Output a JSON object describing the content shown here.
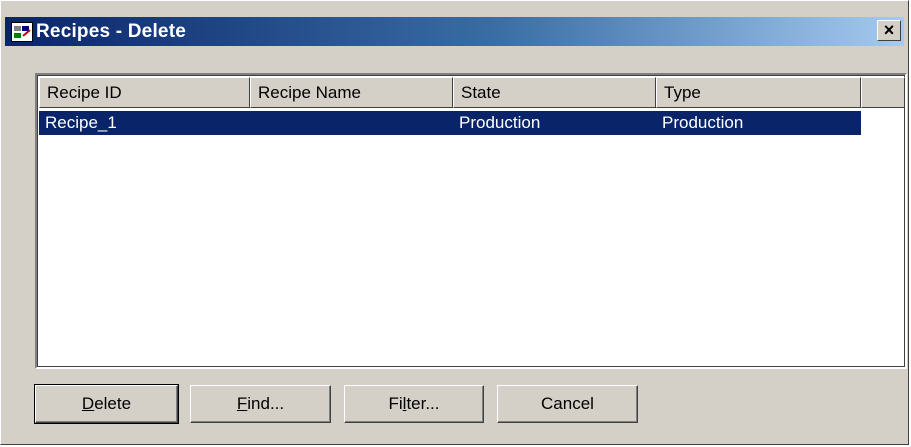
{
  "window": {
    "title": "Recipes - Delete",
    "close_label": "×"
  },
  "list": {
    "columns": [
      "Recipe ID",
      "Recipe Name",
      "State",
      "Type"
    ],
    "rows": [
      {
        "recipe_id": "Recipe_1",
        "recipe_name": "",
        "state": "Production",
        "type": "Production",
        "selected": true
      }
    ]
  },
  "buttons": {
    "delete": {
      "mnemonic": "D",
      "rest": "elete"
    },
    "find": {
      "mnemonic": "F",
      "rest": "ind..."
    },
    "filter": {
      "pre": "Fi",
      "mnemonic": "l",
      "rest": "ter..."
    },
    "cancel": {
      "label": "Cancel"
    }
  },
  "colors": {
    "selection": "#0a246a",
    "titlebar_start": "#0a246a",
    "face": "#d4d0c8"
  }
}
